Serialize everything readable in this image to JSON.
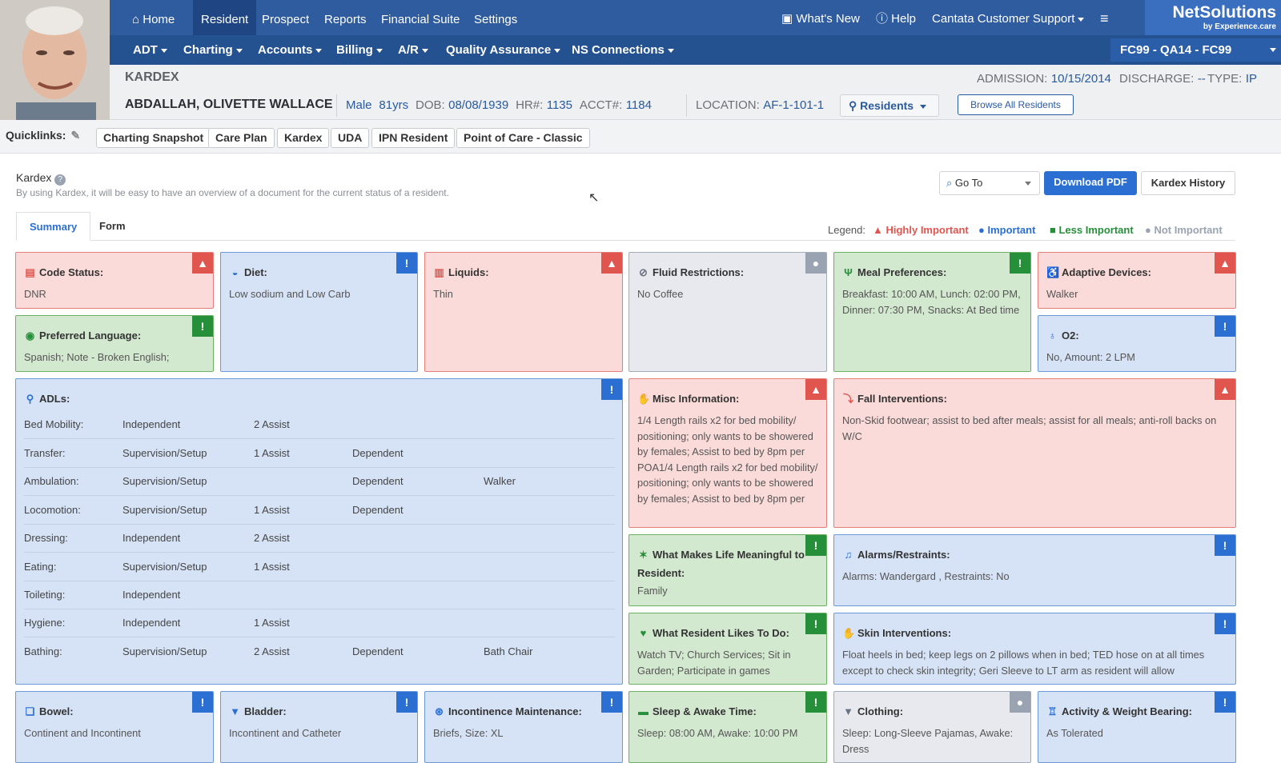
{
  "nav": {
    "main": [
      "Home",
      "Resident",
      "Prospect",
      "Reports",
      "Financial Suite",
      "Settings"
    ],
    "right": [
      "What's New",
      "Help",
      "Cantata Customer Support"
    ],
    "sub": [
      "ADT",
      "Charting",
      "Accounts",
      "Billing",
      "A/R",
      "Quality Assurance",
      "NS Connections"
    ],
    "brand": "NetSolutions",
    "brand_sub": "by Experience.care",
    "facility": "FC99 - QA14 - FC99"
  },
  "resident": {
    "section": "KARDEX",
    "admission_label": "ADMISSION:",
    "admission": "10/15/2014",
    "discharge_label": "DISCHARGE:",
    "discharge": "--",
    "type_label": "TYPE:",
    "type": "IP",
    "name": "ABDALLAH, OLIVETTE WALLACE",
    "gender": "Male",
    "age": "81yrs",
    "dob_label": "DOB:",
    "dob": "08/08/1939",
    "hr_label": "HR#:",
    "hr": "1135",
    "acct_label": "ACCT#:",
    "acct": "1184",
    "location_label": "LOCATION:",
    "location": "AF-1-101-1",
    "residents_button": "Residents",
    "browse_button": "Browse All Residents"
  },
  "quicklinks": {
    "label": "Quicklinks:",
    "items": [
      "Charting Snapshot",
      "Care Plan",
      "Kardex",
      "UDA",
      "IPN Resident",
      "Point of Care - Classic"
    ]
  },
  "page": {
    "title": "Kardex",
    "subtitle": "By using Kardex, it will be easy to have an overview of a document for the current status of a resident.",
    "goto_placeholder": "Go To",
    "download": "Download PDF",
    "history": "Kardex History",
    "tabs": [
      "Summary",
      "Form"
    ]
  },
  "legend": {
    "label": "Legend:",
    "items": [
      "Highly Important",
      "Important",
      "Less Important",
      "Not Important"
    ],
    "colors": {
      "high": "#e0564f",
      "important": "#2c6fd3",
      "less": "#268f3a",
      "not": "#9aa3b1"
    }
  },
  "cards": {
    "code_status": {
      "title": "Code Status:",
      "value": "DNR"
    },
    "diet": {
      "title": "Diet:",
      "value": "Low sodium and Low Carb"
    },
    "liquids": {
      "title": "Liquids:",
      "value": "Thin"
    },
    "fluid": {
      "title": "Fluid Restrictions:",
      "value": "No Coffee"
    },
    "meal": {
      "title": "Meal Preferences:",
      "value": "Breakfast: 10:00 AM, Lunch: 02:00 PM, Dinner: 07:30 PM, Snacks: At Bed time"
    },
    "adaptive": {
      "title": "Adaptive Devices:",
      "value": "Walker"
    },
    "language": {
      "title": "Preferred Language:",
      "value": "Spanish; Note - Broken English;"
    },
    "o2": {
      "title": "O2:",
      "value": "No, Amount: 2 LPM"
    },
    "misc": {
      "title": "Misc Information:",
      "value": "1/4 Length rails x2 for bed mobility/ positioning; only wants to be showered by females; Assist to bed by 8pm per POA1/4 Length rails x2 for bed mobility/ positioning; only wants to be showered by females; Assist to bed by 8pm per"
    },
    "fall": {
      "title": "Fall Interventions:",
      "value": "Non-Skid footwear; assist to bed after meals; assist for all meals; anti-roll backs on W/C"
    },
    "meaningful": {
      "title": "What Makes Life Meaningful to Resident:",
      "value": "Family"
    },
    "alarms": {
      "title": "Alarms/Restraints:",
      "value": "Alarms: Wandergard , Restraints: No"
    },
    "likes": {
      "title": "What Resident Likes To Do:",
      "value": "Watch TV; Church Services; Sit in Garden; Participate in games"
    },
    "skin": {
      "title": "Skin Interventions:",
      "value": "Float heels in bed; keep legs on 2 pillows when in bed; TED hose on at all times except to check skin integrity; Geri Sleeve to LT arm as resident will allow"
    },
    "bowel": {
      "title": "Bowel:",
      "value": "Continent and Incontinent"
    },
    "bladder": {
      "title": "Bladder:",
      "value": "Incontinent and Catheter"
    },
    "incontinence": {
      "title": "Incontinence Maintenance:",
      "value": "Briefs, Size: XL"
    },
    "sleep": {
      "title": "Sleep & Awake Time:",
      "value": "Sleep: 08:00 AM, Awake: 10:00 PM"
    },
    "clothing": {
      "title": "Clothing:",
      "value": "Sleep: Long-Sleeve Pajamas, Awake: Dress"
    },
    "activity": {
      "title": "Activity & Weight Bearing:",
      "value": "As Tolerated"
    }
  },
  "adls": {
    "title": "ADLs:",
    "rows": [
      [
        "Bed Mobility:",
        "Independent",
        "2 Assist",
        "",
        ""
      ],
      [
        "Transfer:",
        "Supervision/Setup",
        "1 Assist",
        "Dependent",
        ""
      ],
      [
        "Ambulation:",
        "Supervision/Setup",
        "",
        "Dependent",
        "Walker"
      ],
      [
        "Locomotion:",
        "Supervision/Setup",
        "1 Assist",
        "Dependent",
        ""
      ],
      [
        "Dressing:",
        "Independent",
        "2 Assist",
        "",
        ""
      ],
      [
        "Eating:",
        "Supervision/Setup",
        "1 Assist",
        "",
        ""
      ],
      [
        "Toileting:",
        "Independent",
        "",
        "",
        ""
      ],
      [
        "Hygiene:",
        "Independent",
        "1 Assist",
        "",
        ""
      ],
      [
        "Bathing:",
        "Supervision/Setup",
        "2 Assist",
        "Dependent",
        "Bath Chair"
      ]
    ]
  }
}
